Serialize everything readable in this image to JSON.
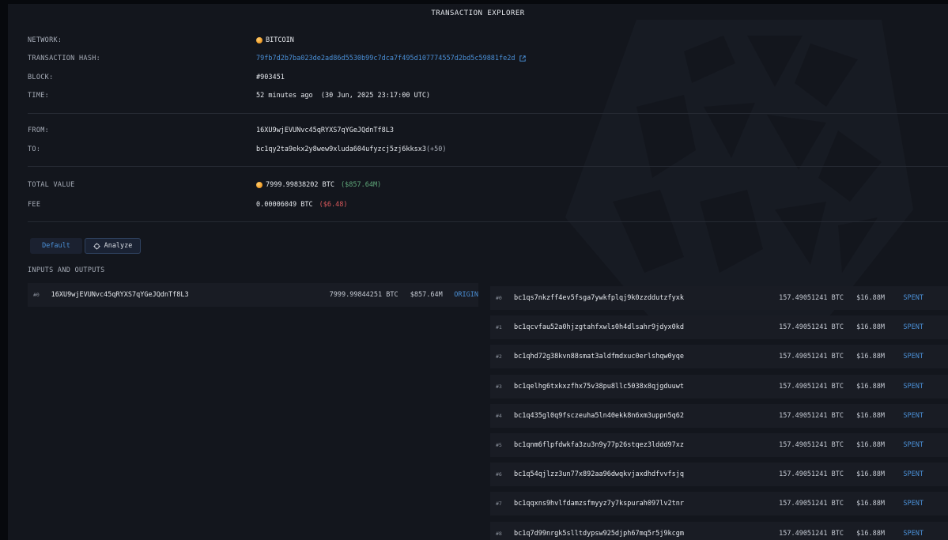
{
  "header": {
    "title": "TRANSACTION EXPLORER"
  },
  "details": {
    "network_label": "NETWORK:",
    "network_value": "BITCOIN",
    "hash_label": "TRANSACTION HASH:",
    "hash_value": "79fb7d2b7ba023de2ad86d5530b99c7dca7f495d107774557d2bd5c59881fe2d",
    "block_label": "BLOCK:",
    "block_value": "#903451",
    "time_label": "TIME:",
    "time_value": "52 minutes ago  (30 Jun, 2025 23:17:00 UTC)",
    "from_label": "FROM:",
    "from_value": "16XU9wjEVUNvc45qRYXS7qYGeJQdnTf8L3",
    "to_label": "TO:",
    "to_value": "bc1qy2ta9ekx2y8wew9xluda604ufyzcj5zj6kksx3",
    "to_more": "(+50)",
    "total_label": "TOTAL VALUE",
    "total_value": "7999.99838202 BTC",
    "total_usd": "($857.64M)",
    "fee_label": "FEE",
    "fee_value": "0.00006049 BTC",
    "fee_usd": "($6.48)"
  },
  "tabs": {
    "default_label": "Default",
    "analyze_label": "Analyze"
  },
  "io": {
    "section_title": "INPUTS AND OUTPUTS",
    "inputs": [
      {
        "index": "#0",
        "address": "16XU9wjEVUNvc45qRYXS7qYGeJQdnTf8L3",
        "btc": "7999.99844251 BTC",
        "usd": "$857.64M",
        "tag": "ORIGIN"
      }
    ],
    "outputs": [
      {
        "index": "#0",
        "address": "bc1qs7nkzff4ev5fsga7ywkfplqj9k0zzddutzfyxk",
        "btc": "157.49051241 BTC",
        "usd": "$16.88M",
        "tag": "SPENT"
      },
      {
        "index": "#1",
        "address": "bc1qcvfau52a0hjzgtahfxwls0h4dlsahr9jdyx0kd",
        "btc": "157.49051241 BTC",
        "usd": "$16.88M",
        "tag": "SPENT"
      },
      {
        "index": "#2",
        "address": "bc1qhd72g38kvn88smat3aldfmdxuc0erlshqw0yqe",
        "btc": "157.49051241 BTC",
        "usd": "$16.88M",
        "tag": "SPENT"
      },
      {
        "index": "#3",
        "address": "bc1qelhg6txkxzfhx75v38pu8llc5038x8qjgduuwt",
        "btc": "157.49051241 BTC",
        "usd": "$16.88M",
        "tag": "SPENT"
      },
      {
        "index": "#4",
        "address": "bc1q435gl0q9fsczeuha5ln40ekk8n6xm3uppn5q62",
        "btc": "157.49051241 BTC",
        "usd": "$16.88M",
        "tag": "SPENT"
      },
      {
        "index": "#5",
        "address": "bc1qnm6flpfdwkfa3zu3n9y77p26stqez3lddd97xz",
        "btc": "157.49051241 BTC",
        "usd": "$16.88M",
        "tag": "SPENT"
      },
      {
        "index": "#6",
        "address": "bc1q54qjlzz3un77x892aa96dwqkvjaxdhdfvvfsjq",
        "btc": "157.49051241 BTC",
        "usd": "$16.88M",
        "tag": "SPENT"
      },
      {
        "index": "#7",
        "address": "bc1qqxns9hvlfdamzsfmyyz7y7kspurah097lv2tnr",
        "btc": "157.49051241 BTC",
        "usd": "$16.88M",
        "tag": "SPENT"
      },
      {
        "index": "#8",
        "address": "bc1q7d99nrgk5slltdypsw925djph67mq5r5j9kcgm",
        "btc": "157.49051241 BTC",
        "usd": "$16.88M",
        "tag": "SPENT"
      }
    ]
  },
  "colors": {
    "accent": "#4a8fd6",
    "positive": "#5fa87a",
    "negative": "#d9585b",
    "panel": "#13161d"
  }
}
